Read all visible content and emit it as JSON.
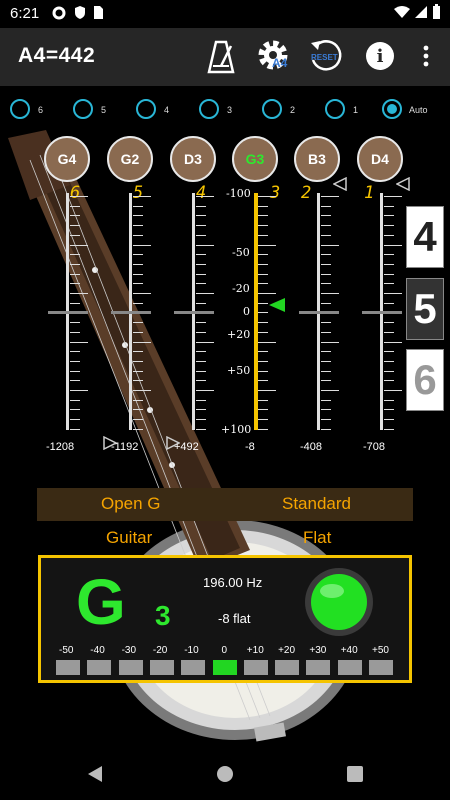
{
  "status_bar": {
    "time": "6:21"
  },
  "app_bar": {
    "title": "A4=442",
    "a4_badge": "A4",
    "reset_label": "RESET",
    "info_label": "i"
  },
  "string_selector": {
    "options": [
      "6",
      "5",
      "4",
      "3",
      "2",
      "1",
      "Auto"
    ],
    "selected": "Auto"
  },
  "notes": [
    "G4",
    "G2",
    "D3",
    "G3",
    "B3",
    "D4"
  ],
  "active_note_index": 3,
  "string_numbers": [
    "6",
    "5",
    "4",
    "3",
    "2",
    "1"
  ],
  "scale_labels": [
    "-100",
    "-50",
    "-20",
    "0",
    "+20",
    "+50",
    "+100"
  ],
  "cents_values": [
    "-1208",
    "-1192",
    "+492",
    "-8",
    "-408",
    "-708"
  ],
  "side_thumbs": [
    "4",
    "5",
    "6"
  ],
  "tuning_options": {
    "row1": [
      "Open G",
      "Standard"
    ],
    "row2": [
      "Guitar",
      "Flat"
    ]
  },
  "display": {
    "note_letter": "G",
    "octave": "3",
    "frequency": "196.00 Hz",
    "deviation": "-8 flat",
    "indicator_color": "#22e022",
    "scale": [
      "-50",
      "-40",
      "-30",
      "-20",
      "-10",
      "0",
      "+10",
      "+20",
      "+30",
      "+40",
      "+50"
    ],
    "lit_segment_index": 5
  },
  "colors": {
    "accent": "#f5c400",
    "radio": "#29b6d6",
    "note_bg": "#8a6a50",
    "active_green": "#2ee82e",
    "tuning_text": "#f5a400"
  }
}
